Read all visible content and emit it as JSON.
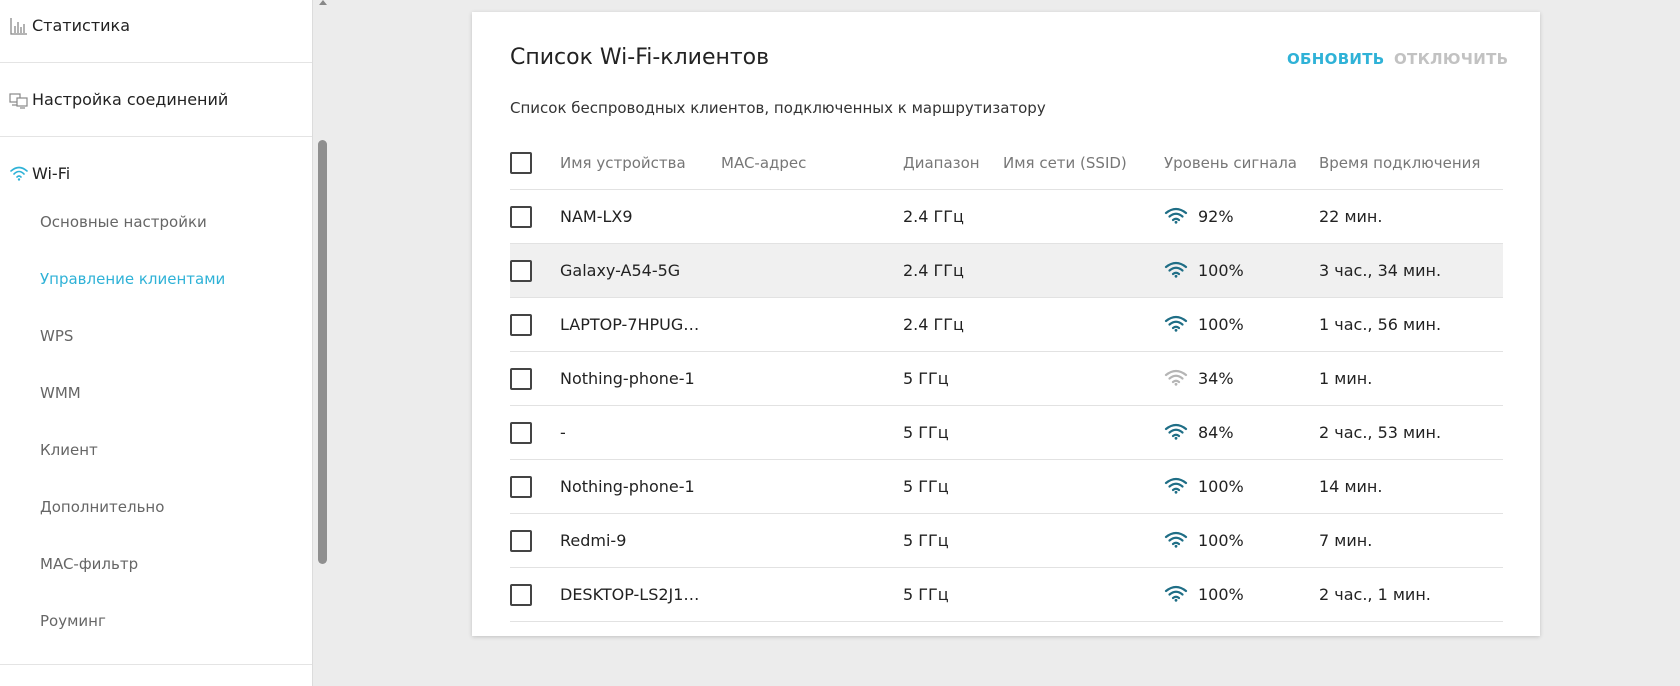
{
  "sidebar": {
    "sections": [
      {
        "label": "Статистика",
        "icon": "bar-chart-icon"
      },
      {
        "label": "Настройка соединений",
        "icon": "network-devices-icon"
      },
      {
        "label": "Wi-Fi",
        "icon": "wifi-icon"
      }
    ],
    "wifi_items": [
      {
        "label": "Основные настройки",
        "active": false
      },
      {
        "label": "Управление клиентами",
        "active": true
      },
      {
        "label": "WPS",
        "active": false
      },
      {
        "label": "WMM",
        "active": false
      },
      {
        "label": "Клиент",
        "active": false
      },
      {
        "label": "Дополнительно",
        "active": false
      },
      {
        "label": "MAC-фильтр",
        "active": false
      },
      {
        "label": "Роуминг",
        "active": false
      }
    ]
  },
  "card": {
    "title": "Список Wi-Fi-клиентов",
    "refresh_label": "ОБНОВИТЬ",
    "disconnect_label": "ОТКЛЮЧИТЬ",
    "subtitle": "Список беспроводных клиентов, подключенных к маршрутизатору"
  },
  "table": {
    "headers": {
      "name": "Имя устройства",
      "mac": "MAC-адрес",
      "band": "Диапазон",
      "ssid": "Имя сети (SSID)",
      "signal": "Уровень сигнала",
      "time": "Время подключения"
    },
    "rows": [
      {
        "name": "NAM-LX9",
        "mac": "",
        "band": "2.4 ГГц",
        "ssid": "",
        "signal": "92%",
        "strength": "strong",
        "time": "22 мин.",
        "highlighted": false
      },
      {
        "name": "Galaxy-A54-5G",
        "mac": "",
        "band": "2.4 ГГц",
        "ssid": "",
        "signal": "100%",
        "strength": "strong",
        "time": "3 час., 34 мин.",
        "highlighted": true
      },
      {
        "name": "LAPTOP-7HPUG…",
        "mac": "",
        "band": "2.4 ГГц",
        "ssid": "",
        "signal": "100%",
        "strength": "strong",
        "time": "1 час., 56 мин.",
        "highlighted": false
      },
      {
        "name": "Nothing-phone-1",
        "mac": "",
        "band": "5 ГГц",
        "ssid": "",
        "signal": "34%",
        "strength": "weak",
        "time": "1 мин.",
        "highlighted": false
      },
      {
        "name": "-",
        "mac": "",
        "band": "5 ГГц",
        "ssid": "",
        "signal": "84%",
        "strength": "strong",
        "time": "2 час., 53 мин.",
        "highlighted": false
      },
      {
        "name": "Nothing-phone-1",
        "mac": "",
        "band": "5 ГГц",
        "ssid": "",
        "signal": "100%",
        "strength": "strong",
        "time": "14 мин.",
        "highlighted": false
      },
      {
        "name": "Redmi-9",
        "mac": "",
        "band": "5 ГГц",
        "ssid": "",
        "signal": "100%",
        "strength": "strong",
        "time": "7 мин.",
        "highlighted": false
      },
      {
        "name": "DESKTOP-LS2J1…",
        "mac": "",
        "band": "5 ГГц",
        "ssid": "",
        "signal": "100%",
        "strength": "strong",
        "time": "2 час., 1 мин.",
        "highlighted": false
      }
    ]
  },
  "colors": {
    "accent": "#2fb2d7",
    "signal_strong": "#1f6e86",
    "signal_weak": "#b5b5b5",
    "disabled": "#c2c2c2"
  }
}
